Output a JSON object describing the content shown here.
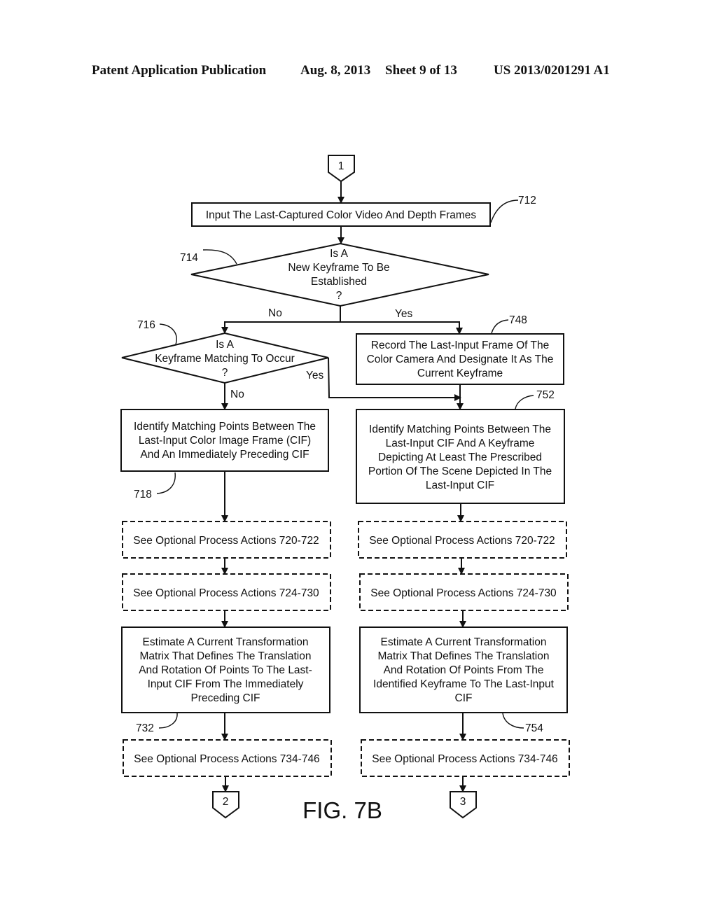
{
  "header": {
    "publication": "Patent Application Publication",
    "date": "Aug. 8, 2013",
    "sheet": "Sheet 9 of 13",
    "number": "US 2013/0201291 A1"
  },
  "figure_label": "FIG. 7B",
  "connectors": {
    "top": "1",
    "bottom_left": "2",
    "bottom_right": "3"
  },
  "nodes": {
    "n712": {
      "ref": "712",
      "lines": [
        "Input The Last-Captured Color Video And Depth Frames"
      ]
    },
    "n714": {
      "ref": "714",
      "lines": [
        "Is A",
        "New Keyframe To Be",
        "Established",
        "?"
      ]
    },
    "n716": {
      "ref": "716",
      "lines": [
        "Is A",
        "Keyframe Matching To Occur",
        "?"
      ]
    },
    "n748": {
      "ref": "748",
      "lines": [
        "Record The Last-Input Frame Of The",
        "Color Camera And Designate It As The",
        "Current Keyframe"
      ]
    },
    "n718": {
      "ref": "718",
      "lines": [
        "Identify Matching Points Between The",
        "Last-Input Color Image Frame (CIF)",
        "And An Immediately Preceding CIF"
      ]
    },
    "n752": {
      "ref": "752",
      "lines": [
        "Identify Matching Points Between The",
        "Last-Input CIF And A Keyframe",
        "Depicting At Least The Prescribed",
        "Portion Of The Scene Depicted In The",
        "Last-Input CIF"
      ]
    },
    "opt720_left": {
      "lines": [
        "See Optional Process Actions 720-722"
      ]
    },
    "opt720_right": {
      "lines": [
        "See Optional Process Actions 720-722"
      ]
    },
    "opt724_left": {
      "lines": [
        "See Optional Process Actions 724-730"
      ]
    },
    "opt724_right": {
      "lines": [
        "See Optional Process Actions 724-730"
      ]
    },
    "n732": {
      "ref": "732",
      "lines": [
        "Estimate A Current Transformation",
        "Matrix That Defines The Translation",
        "And Rotation Of Points To The Last-",
        "Input CIF From The Immediately",
        "Preceding CIF"
      ]
    },
    "n754": {
      "ref": "754",
      "lines": [
        "Estimate A Current Transformation",
        "Matrix That Defines The Translation",
        "And Rotation Of Points From The",
        "Identified Keyframe To The Last-Input",
        "CIF"
      ]
    },
    "opt734_left": {
      "lines": [
        "See Optional Process Actions 734-746"
      ]
    },
    "opt734_right": {
      "lines": [
        "See Optional Process Actions 734-746"
      ]
    }
  },
  "edge_labels": {
    "d714_no": "No",
    "d714_yes": "Yes",
    "d716_yes": "Yes",
    "d716_no": "No"
  }
}
